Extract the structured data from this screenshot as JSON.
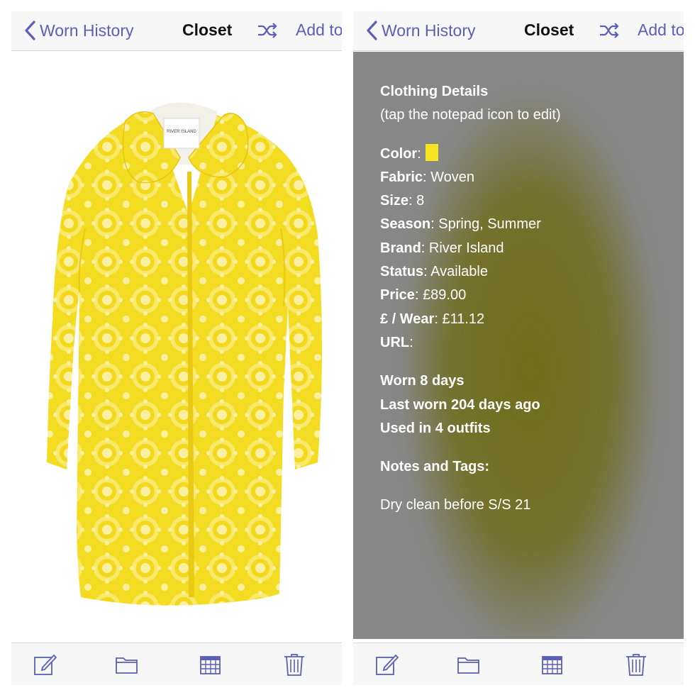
{
  "nav": {
    "back_label": "Worn History",
    "title": "Closet",
    "add_label": "Add to"
  },
  "details": {
    "heading": "Clothing Details",
    "subheading": "(tap the notepad icon to edit)",
    "fields": {
      "color_label": "Color",
      "color_value": "#f6e522",
      "fabric_label": "Fabric",
      "fabric_value": "Woven",
      "size_label": "Size",
      "size_value": "8",
      "season_label": "Season",
      "season_value": "Spring, Summer",
      "brand_label": "Brand",
      "brand_value": "River Island",
      "status_label": "Status",
      "status_value": "Available",
      "price_label": "Price",
      "price_value": "£89.00",
      "cpw_label": "£ / Wear",
      "cpw_value": "£11.12",
      "url_label": "URL",
      "url_value": ""
    },
    "stats": {
      "worn": "Worn 8 days",
      "last_worn": "Last worn 204 days ago",
      "used_in": "Used in 4 outfits"
    },
    "notes_heading": "Notes and Tags:",
    "notes": "Dry clean before S/S 21"
  },
  "garment": {
    "tag_brand": "RIVER ISLAND"
  },
  "colors": {
    "accent": "#5b5fb8",
    "coat": "#f6dd1f",
    "details_bg": "#878787"
  },
  "toolbar": {
    "icons": [
      "notepad-edit-icon",
      "folder-icon",
      "calendar-icon",
      "trash-icon"
    ]
  }
}
